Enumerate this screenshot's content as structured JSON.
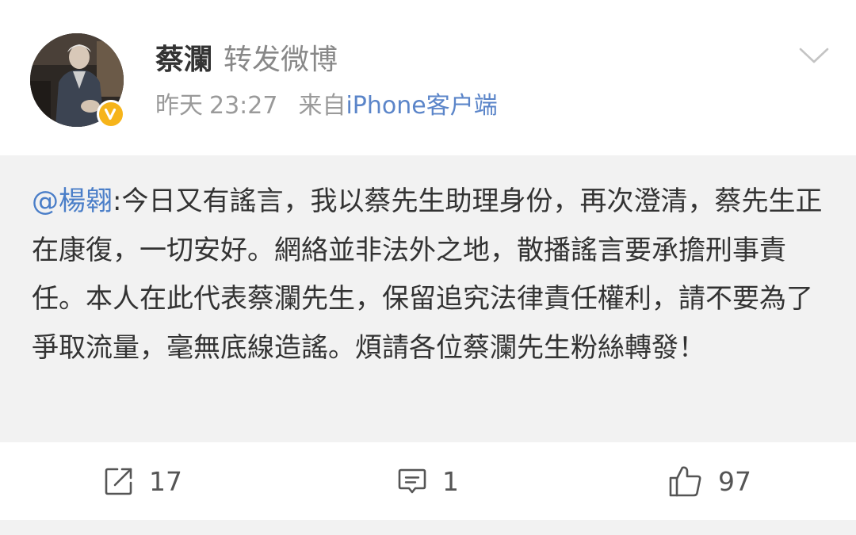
{
  "post": {
    "author": "蔡瀾",
    "action": "转发微博",
    "time_day": "昨天",
    "time_clock": "23:27",
    "from_prefix": "来自",
    "source": "iPhone客户端"
  },
  "repost": {
    "mention": "@楊翱",
    "separator": ":",
    "text": "今日又有謠言，我以蔡先生助理身份，再次澄清，蔡先生正在康復，一切安好。網絡並非法外之地，散播謠言要承擔刑事責任。本人在此代表蔡瀾先生，保留追究法律責任權利，請不要為了爭取流量，毫無底線造謠。煩請各位蔡瀾先生粉絲轉發！"
  },
  "stats": {
    "reposts": "17",
    "comments": "1",
    "likes": "97"
  },
  "icons": {
    "menu": "chevron-down-icon",
    "verified": "verified-v-icon",
    "repost": "repost-icon",
    "comment": "comment-icon",
    "like": "thumbs-up-icon"
  },
  "colors": {
    "link": "#4a7ec8",
    "badge": "#f6b41a",
    "repost_background": "#f2f2f2"
  }
}
